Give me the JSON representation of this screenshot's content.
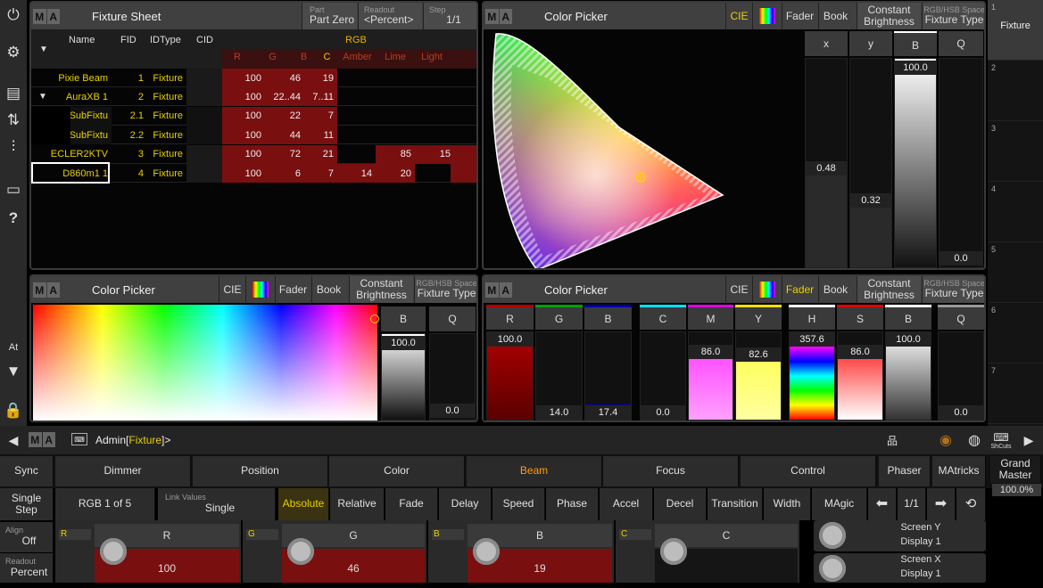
{
  "sidebar": {
    "at_label": "At"
  },
  "fixture_sheet": {
    "title": "Fixture Sheet",
    "part_label": "Part",
    "part_value": "Part Zero",
    "readout_label": "Readout",
    "readout_value": "<Percent>",
    "step_label": "Step",
    "step_value": "1/1",
    "headers": {
      "name": "Name",
      "fid": "FID",
      "idtype": "IDType",
      "cid": "CID",
      "rgb": "RGB"
    },
    "subheaders": [
      "R",
      "G",
      "B",
      "C",
      "Amber",
      "Lime",
      "Light"
    ],
    "rows": [
      {
        "name": "Pixie Beam",
        "fid": "1",
        "type": "Fixture",
        "r": "100",
        "g": "46",
        "b": "19",
        "c": "",
        "amber": "",
        "lime": ""
      },
      {
        "name": "AuraXB 1",
        "fid": "2",
        "type": "Fixture",
        "r": "100",
        "g": "22..44",
        "b": "7..11",
        "c": "",
        "amber": "",
        "lime": ""
      },
      {
        "name": "SubFixtu",
        "fid": "2.1",
        "type": "Fixture",
        "r": "100",
        "g": "22",
        "b": "7",
        "c": "",
        "amber": "",
        "lime": ""
      },
      {
        "name": "SubFixtu",
        "fid": "2.2",
        "type": "Fixture",
        "r": "100",
        "g": "44",
        "b": "11",
        "c": "",
        "amber": "",
        "lime": ""
      },
      {
        "name": "ECLER2KTV",
        "fid": "3",
        "type": "Fixture",
        "r": "100",
        "g": "72",
        "b": "21",
        "c": "",
        "amber": "85",
        "lime": "15"
      },
      {
        "name": "D860m1 1",
        "fid": "4",
        "type": "Fixture",
        "r": "100",
        "g": "6",
        "b": "7",
        "c": "14",
        "amber": "20",
        "lime": ""
      }
    ]
  },
  "cp_top": {
    "title": "Color Picker",
    "tab_cie": "CIE",
    "tab_fader": "Fader",
    "tab_book": "Book",
    "constant": "Constant Brightness",
    "space_label": "RGB/HSB Space",
    "space_value": "Fixture Type",
    "x_label": "x",
    "y_label": "y",
    "b_label": "B",
    "q_label": "Q",
    "x_value": "0.48",
    "y_value": "0.32",
    "b_value": "100.0",
    "q_value": "0.0"
  },
  "cp_left": {
    "title": "Color Picker",
    "tab_cie": "CIE",
    "tab_fader": "Fader",
    "tab_book": "Book",
    "constant": "Constant Brightness",
    "space_label": "RGB/HSB Space",
    "space_value": "Fixture Type",
    "b_label": "B",
    "q_label": "Q",
    "b_value": "100.0",
    "q_value": "0.0"
  },
  "cp_right": {
    "title": "Color Picker",
    "tab_cie": "CIE",
    "tab_fader": "Fader",
    "tab_book": "Book",
    "constant": "Constant Brightness",
    "space_label": "RGB/HSB Space",
    "space_value": "Fixture Type",
    "faders": [
      {
        "label": "R",
        "value": "100.0",
        "level": 1.0
      },
      {
        "label": "G",
        "value": "14.0",
        "level": 0.14
      },
      {
        "label": "B",
        "value": "17.4",
        "level": 0.174
      },
      {
        "label": "C",
        "value": "0.0",
        "level": 0.0
      },
      {
        "label": "M",
        "value": "86.0",
        "level": 0.86
      },
      {
        "label": "Y",
        "value": "82.6",
        "level": 0.826
      },
      {
        "label": "H",
        "value": "357.6",
        "level": 1.0
      },
      {
        "label": "S",
        "value": "86.0",
        "level": 0.86
      },
      {
        "label": "B",
        "value": "100.0",
        "level": 1.0
      },
      {
        "label": "Q",
        "value": "0.0",
        "level": 0.0
      }
    ]
  },
  "executor_strip": {
    "items": [
      "1",
      "2",
      "3",
      "4",
      "5",
      "6",
      "7"
    ],
    "first_label": "Fixture"
  },
  "cmdline": {
    "prefix": "Admin",
    "bracket_open": "[",
    "context": "Fixture",
    "bracket_close": "]",
    "suffix": ">",
    "shcuts": "ShCuts"
  },
  "feature_row": {
    "sync": "Sync",
    "groups": [
      "Dimmer",
      "Position",
      "Color",
      "Beam",
      "Focus",
      "Control"
    ],
    "phaser": "Phaser",
    "matricks": "MAtricks",
    "grand_master": "Grand Master",
    "grand_value": "100.0%"
  },
  "mode_row": {
    "single_step": "Single Step",
    "rgb": "RGB 1 of 5",
    "link_label": "Link Values",
    "link_value": "Single",
    "modes": [
      "Absolute",
      "Relative",
      "Fade",
      "Delay",
      "Speed",
      "Phase",
      "Accel",
      "Decel",
      "Transition",
      "Width",
      "MAgic"
    ],
    "page": "1/1"
  },
  "enc_row": {
    "align_label": "Align",
    "align_value": "Off",
    "readout_label": "Readout",
    "readout_value": "Percent",
    "encoders": [
      {
        "tag": "R",
        "label": "R",
        "value": "100"
      },
      {
        "tag": "G",
        "label": "G",
        "value": "46"
      },
      {
        "tag": "B",
        "label": "B",
        "value": "19"
      },
      {
        "tag": "C",
        "label": "C",
        "value": ""
      }
    ],
    "screen_y": "Screen Y",
    "display_y": "Display 1",
    "screen_x": "Screen X",
    "display_x": "Display 1"
  },
  "colors": {
    "accent": "#e8d000",
    "active_orange": "#ff9a1a",
    "cell_red": "#7a0f10",
    "panel": "#2c2c2c"
  }
}
